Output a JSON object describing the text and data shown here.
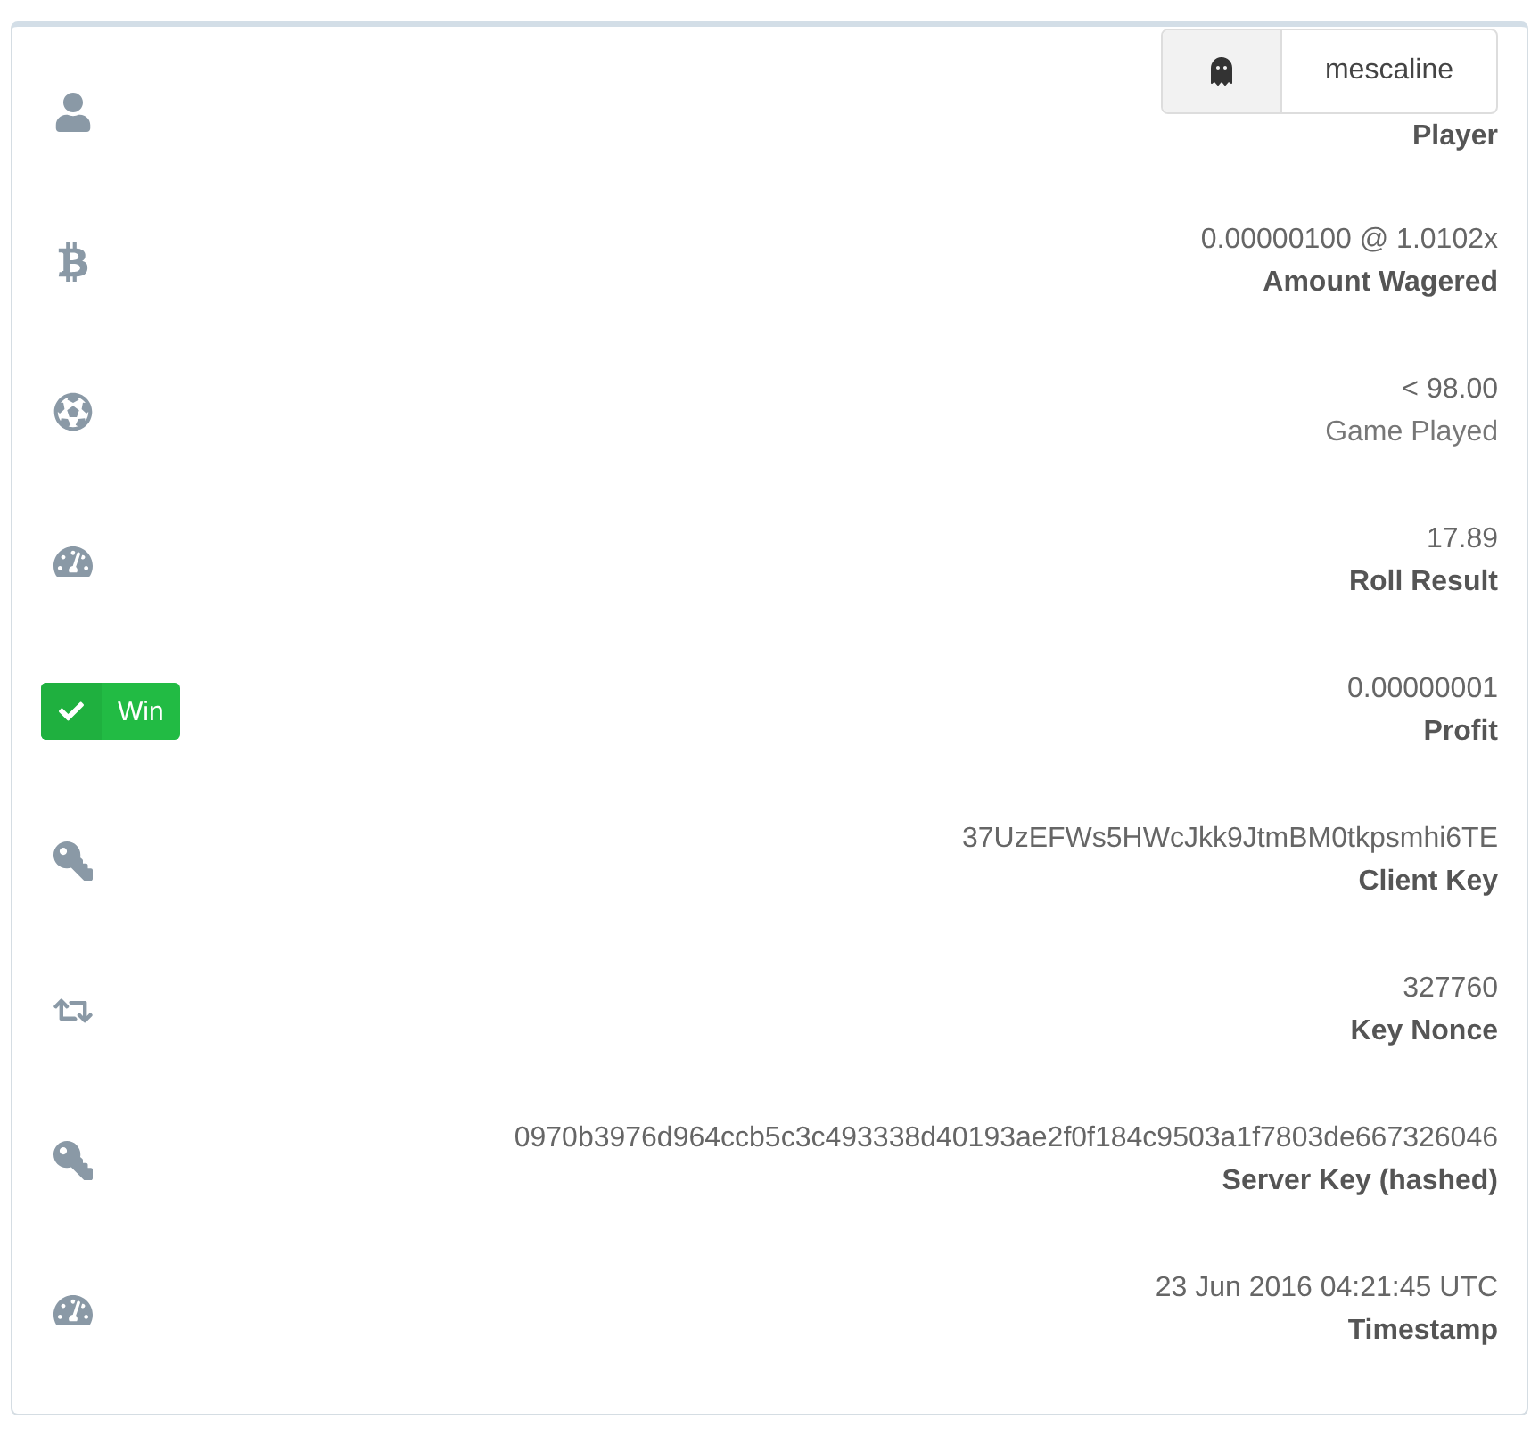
{
  "rows": [
    {
      "kind": "player",
      "value": "mescaline",
      "label": "Player",
      "label_bold": true
    },
    {
      "kind": "plain",
      "value": "0.00000100 @ 1.0102x",
      "label": "Amount Wagered",
      "label_bold": true
    },
    {
      "kind": "plain",
      "value": "< 98.00",
      "label": "Game Played",
      "label_bold": false
    },
    {
      "kind": "plain",
      "value": "17.89",
      "label": "Roll Result",
      "label_bold": true
    },
    {
      "kind": "outcome",
      "badge": "Win",
      "value": "0.00000001",
      "label": "Profit",
      "label_bold": true
    },
    {
      "kind": "plain",
      "value": "37UzEFWs5HWcJkk9JtmBM0tkpsmhi6TE",
      "label": "Client Key",
      "label_bold": true
    },
    {
      "kind": "plain",
      "value": "327760",
      "label": "Key Nonce",
      "label_bold": true
    },
    {
      "kind": "plain",
      "value": "0970b3976d964ccb5c3c493338d40193ae2f0f184c9503a1f7803de667326046",
      "label": "Server Key (hashed)",
      "label_bold": true
    },
    {
      "kind": "plain",
      "value": "23 Jun 2016 04:21:45 UTC",
      "label": "Timestamp",
      "label_bold": true
    }
  ]
}
